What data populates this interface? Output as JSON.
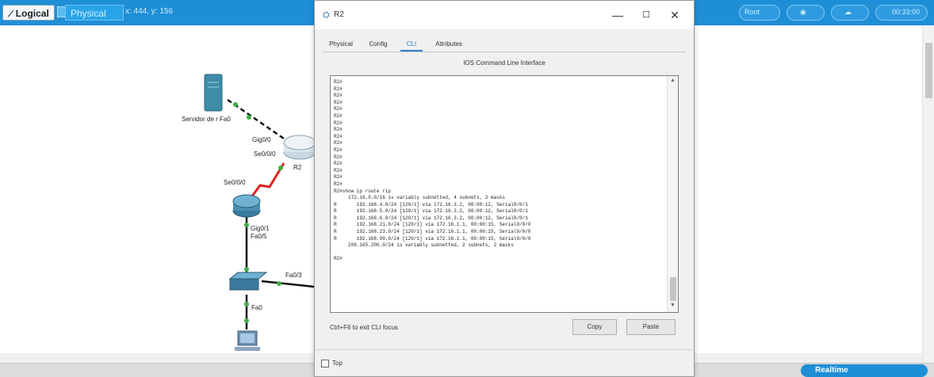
{
  "toolbar": {
    "logical_label": "Logical",
    "physical_label": "Physical",
    "coords": "x: 444, y: 156",
    "right_labels": [
      "Root",
      "00:33:00"
    ]
  },
  "network": {
    "server_label": "Servidor de r Fa0",
    "router_ports": [
      "Gig0/0",
      "Se0/0/0"
    ],
    "router_name": "R2",
    "router2_port": "Se0/0/0",
    "router2_lower_ports": [
      "Gig0/1",
      "Fa0/5"
    ],
    "switch_port": "Fa0/3",
    "pc_port": "Fa0"
  },
  "window": {
    "title": "R2",
    "minimize_glyph": "—",
    "maximize_glyph": "☐",
    "close_glyph": "✕",
    "tabs": [
      "Physical",
      "Config",
      "CLI",
      "Attributes"
    ],
    "active_tab": "CLI",
    "section_title": "IOS Command Line Interface",
    "console_lines": [
      "R2#",
      "R2#",
      "R2#",
      "R2#",
      "R2#",
      "R2#",
      "R2#",
      "R2#",
      "R2#",
      "R2#",
      "R2#",
      "R2#",
      "R2#",
      "R2#",
      "R2#",
      "R2#",
      "R2#show ip route rip",
      "     172.16.0.0/16 is variably subnetted, 4 subnets, 2 masks",
      "R       192.168.4.0/24 [120/1] via 172.16.3.2, 00:00:12, Serial0/0/1",
      "R       192.168.5.0/24 [120/1] via 172.16.3.2, 00:00:12, Serial0/0/1",
      "R       192.168.6.0/24 [120/1] via 172.16.3.2, 00:00:12, Serial0/0/1",
      "R       192.168.21.0/24 [120/1] via 172.16.1.1, 00:00:15, Serial0/0/0",
      "R       192.168.23.0/24 [120/1] via 172.16.1.1, 00:00:15, Serial0/0/0",
      "R       192.168.99.0/24 [120/1] via 172.16.1.1, 00:00:15, Serial0/0/0",
      "     209.165.200.0/24 is variably subnetted, 2 subnets, 2 masks",
      "",
      "R2#"
    ],
    "focus_hint": "Ctrl+F6 to exit CLI focus",
    "copy_label": "Copy",
    "paste_label": "Paste",
    "top_label": "Top"
  },
  "statusbar": {
    "realtime_label": "Realtime"
  },
  "colors": {
    "toolbar_blue": "#1e8fd6",
    "serial_link": "#e02020",
    "ethernet_link": "#111111",
    "port_up": "#3cb043",
    "active_tab": "#2e7fc9"
  }
}
